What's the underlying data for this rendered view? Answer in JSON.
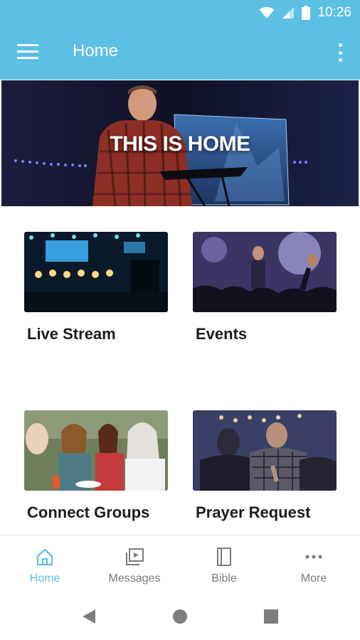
{
  "status_bar": {
    "time": "10:26",
    "icons": [
      "wifi-icon",
      "cell-signal-icon",
      "battery-icon"
    ]
  },
  "app_bar": {
    "title": "Home",
    "menu_icon": "hamburger-menu-icon",
    "overflow_icon": "more-vertical-icon"
  },
  "hero": {
    "text": "THIS IS HOME"
  },
  "tiles": [
    {
      "label": "Live Stream"
    },
    {
      "label": "Events"
    },
    {
      "label": "Connect Groups"
    },
    {
      "label": "Prayer Request"
    }
  ],
  "bottom_nav": {
    "items": [
      {
        "label": "Home",
        "icon": "home-icon",
        "active": true
      },
      {
        "label": "Messages",
        "icon": "video-library-icon",
        "active": false
      },
      {
        "label": "Bible",
        "icon": "book-icon",
        "active": false
      },
      {
        "label": "More",
        "icon": "more-horizontal-icon",
        "active": false
      }
    ]
  },
  "system_nav": {
    "icons": [
      "back-icon",
      "home-circle-icon",
      "recents-icon"
    ]
  },
  "colors": {
    "accent": "#5bc0e3",
    "text": "#1d1d1d",
    "nav_inactive": "#7a7a7a"
  }
}
